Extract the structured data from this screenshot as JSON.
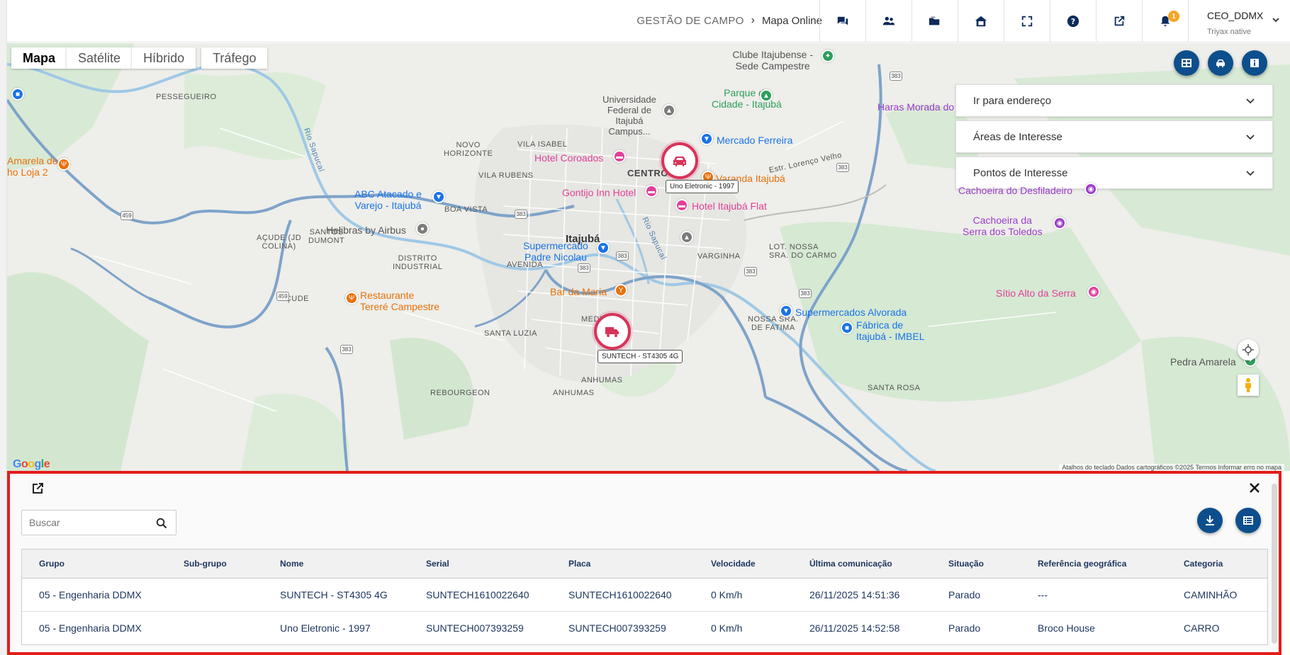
{
  "header": {
    "breadcrumb_root": "GESTÃO DE CAMPO",
    "breadcrumb_current": "Mapa Online",
    "notification_count": "1",
    "user_name": "CEO_DDMX",
    "user_subtitle": "Triyax native"
  },
  "map": {
    "types": [
      "Mapa",
      "Satélite",
      "Híbrido",
      "Tráfego"
    ],
    "panels": {
      "goto_address": "Ir para endereço",
      "areas": "Áreas de Interesse",
      "points": "Pontos de Interesse"
    },
    "labels": {
      "pessegueiro": "PESSEGUEIRO",
      "novo_horizonte": "NOVO\nHORIZONTE",
      "vila_isabel": "VILA ISABEL",
      "vila_rubens": "VILA RUBENS",
      "centro": "CENTRO",
      "boa_vista": "BOA VISTA",
      "acude": "AÇUDE (JD\nCOLINA)",
      "santos_dumont": "SANTOS\nDUMONT",
      "itajuba": "Itajubá",
      "avenida": "AVENIDA",
      "distrito": "DISTRITO\nINDUSTRIAL",
      "acude2": "AÇUDE",
      "varginha": "VARGINHA",
      "lot_nossa": "LOT. NOSSA\nSRA. DO CARMO",
      "santa_luzia": "SANTA LUZIA",
      "medicina": "MEDI",
      "anhumas": "ANHUMAS",
      "rebourgeon": "REBOURGEON",
      "anhumas2": "ANHUMAS",
      "nossa_fatima": "NOSSA SRA.\nDE FATIMA",
      "santa_rosa": "SANTA ROSA",
      "rio_sapucai": "Rio Sapucaí",
      "rio_sapucai2": "Rio Sapucaí",
      "estr_lorenco": "Estr. Lorenço Velho"
    },
    "pois": {
      "clube": "Clube Itajubense -\nSede Campestre",
      "universidade": "Universidade\nFederal de\nItajubá\nCampus...",
      "parque": "Parque da\nCidade - Itajubá",
      "mercado_ferreira": "Mercado Ferreira",
      "hotel_coroados": "Hotel Coroados",
      "varanda": "Varanda Itajubá",
      "gontijo": "Gontijo Inn Hotel",
      "hotel_flat": "Hotel Itajubá Flat",
      "abc": "ABC Atacado e\nVarejo - Itajubá",
      "helibras": "Helibras by Airbus",
      "supermercado_padre": "Supermercado\nPadre Nicolau",
      "bar_maria": "Bar da Maria",
      "restaurante": "Restaurante\nTereré Campestre",
      "haras": "Haras Morada do",
      "cachoeira_desf": "Cachoeira do Desfiladeiro",
      "cachoeira_serra": "Cachoeira da\nSerra dos Toledos",
      "sitio": "Sítio Alto da Serra",
      "supermercados_alvorada": "Supermercados Alvorada",
      "fabrica": "Fábrica de\nItajubá - IMBEL",
      "pedra": "Pedra Amarela",
      "amarela": "Amarela de\nho Loja 2"
    },
    "shields": [
      "383",
      "383",
      "383",
      "383",
      "383",
      "383",
      "383",
      "459",
      "459",
      "383"
    ],
    "vehicles": {
      "car_label": "Uno Eletronic - 1997",
      "truck_label": "SUNTECH - ST4305 4G"
    },
    "google": "Google",
    "footer": "Atalhos do teclado   Dados cartográficos ©2025   Termos   Informar erro no mapa"
  },
  "panel": {
    "search_placeholder": "Buscar",
    "columns": [
      "Grupo",
      "Sub-grupo",
      "Nome",
      "Serial",
      "Placa",
      "Velocidade",
      "Última comunicação",
      "Situação",
      "Referência geográfica",
      "Categoria"
    ],
    "rows": [
      [
        "05 - Engenharia DDMX",
        "",
        "SUNTECH - ST4305 4G",
        "SUNTECH1610022640",
        "SUNTECH1610022640",
        "0 Km/h",
        "26/11/2025 14:51:36",
        "Parado",
        "---",
        "CAMINHÃO"
      ],
      [
        "05 - Engenharia DDMX",
        "",
        "Uno Eletronic - 1997",
        "SUNTECH007393259",
        "SUNTECH007393259",
        "0 Km/h",
        "26/11/2025 14:52:58",
        "Parado",
        "Broco House",
        "CARRO"
      ]
    ]
  },
  "colors": {
    "accent": "#0d4f8c",
    "marker": "#d7345b",
    "panel_border": "#e31b1b"
  }
}
